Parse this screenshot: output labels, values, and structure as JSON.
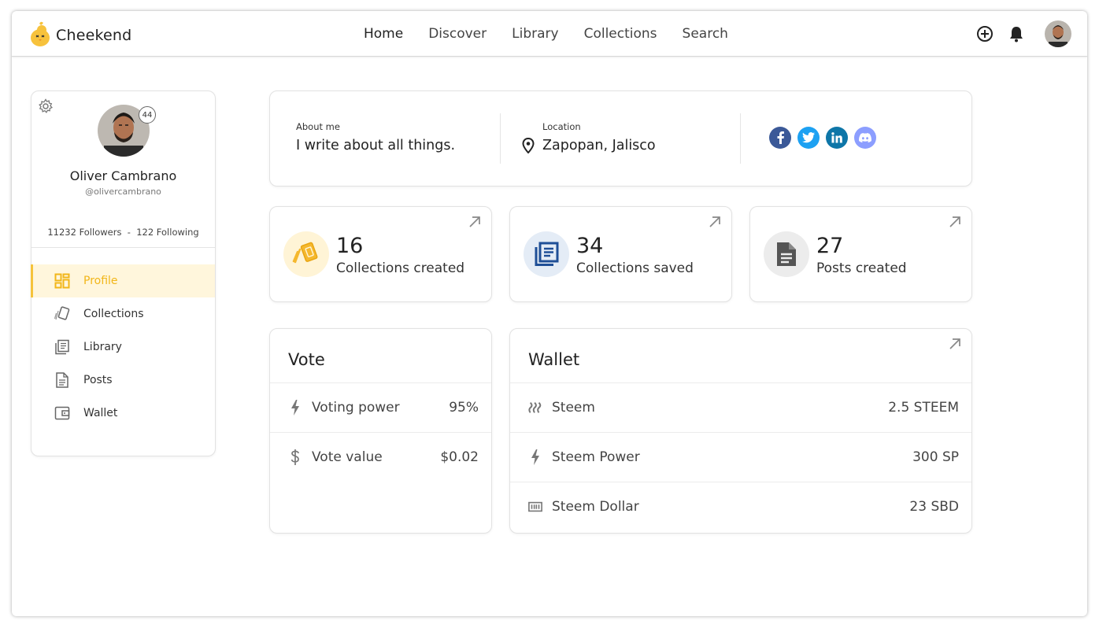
{
  "app": {
    "name": "Cheekend"
  },
  "nav": {
    "items": [
      {
        "label": "Home"
      },
      {
        "label": "Discover"
      },
      {
        "label": "Library"
      },
      {
        "label": "Collections"
      },
      {
        "label": "Search"
      }
    ]
  },
  "topbar": {
    "icons": [
      "plus-circle-icon",
      "bell-icon",
      "user-avatar"
    ]
  },
  "profile": {
    "name": "Oliver Cambrano",
    "handle": "@olivercambrano",
    "level": "44",
    "followers_text": "11232 Followers  -  122 Following"
  },
  "sidebar": {
    "items": [
      {
        "label": "Profile",
        "icon": "dashboard-icon",
        "active": true
      },
      {
        "label": "Collections",
        "icon": "cards-icon",
        "active": false
      },
      {
        "label": "Library",
        "icon": "library-icon",
        "active": false
      },
      {
        "label": "Posts",
        "icon": "document-icon",
        "active": false
      },
      {
        "label": "Wallet",
        "icon": "wallet-icon",
        "active": false
      }
    ]
  },
  "about": {
    "about_label": "About me",
    "about_value": "I write about all things.",
    "location_label": "Location",
    "location_value": "Zapopan, Jalisco",
    "socials": [
      {
        "name": "facebook",
        "glyph": "f",
        "color": "#3b5998"
      },
      {
        "name": "twitter",
        "glyph": "t",
        "color": "#1da1f2"
      },
      {
        "name": "linkedin",
        "glyph": "in",
        "color": "#0e76a8"
      },
      {
        "name": "discord",
        "glyph": "d",
        "color": "#8c9eff"
      }
    ]
  },
  "stats": [
    {
      "value": "16",
      "label": "Collections created",
      "icon": "cards-icon",
      "bg": "#fff4d6",
      "color": "#f5b82e"
    },
    {
      "value": "34",
      "label": "Collections saved",
      "icon": "library-icon",
      "bg": "#e4ecf6",
      "color": "#1f4f97"
    },
    {
      "value": "27",
      "label": "Posts created",
      "icon": "document-icon",
      "bg": "#ececec",
      "color": "#555555"
    }
  ],
  "vote": {
    "title": "Vote",
    "rows": [
      {
        "label": "Voting power",
        "value": "95%",
        "icon": "bolt-icon"
      },
      {
        "label": "Vote value",
        "value": "$0.02",
        "icon": "dollar-icon"
      }
    ]
  },
  "wallet": {
    "title": "Wallet",
    "rows": [
      {
        "label": "Steem",
        "value": "2.5 STEEM",
        "icon": "steem-icon"
      },
      {
        "label": "Steem Power",
        "value": "300 SP",
        "icon": "bolt-icon"
      },
      {
        "label": "Steem Dollar",
        "value": "23 SBD",
        "icon": "banknote-icon"
      }
    ]
  },
  "colors": {
    "accent": "#f5c33b",
    "accent_bg": "#fff6dc"
  }
}
